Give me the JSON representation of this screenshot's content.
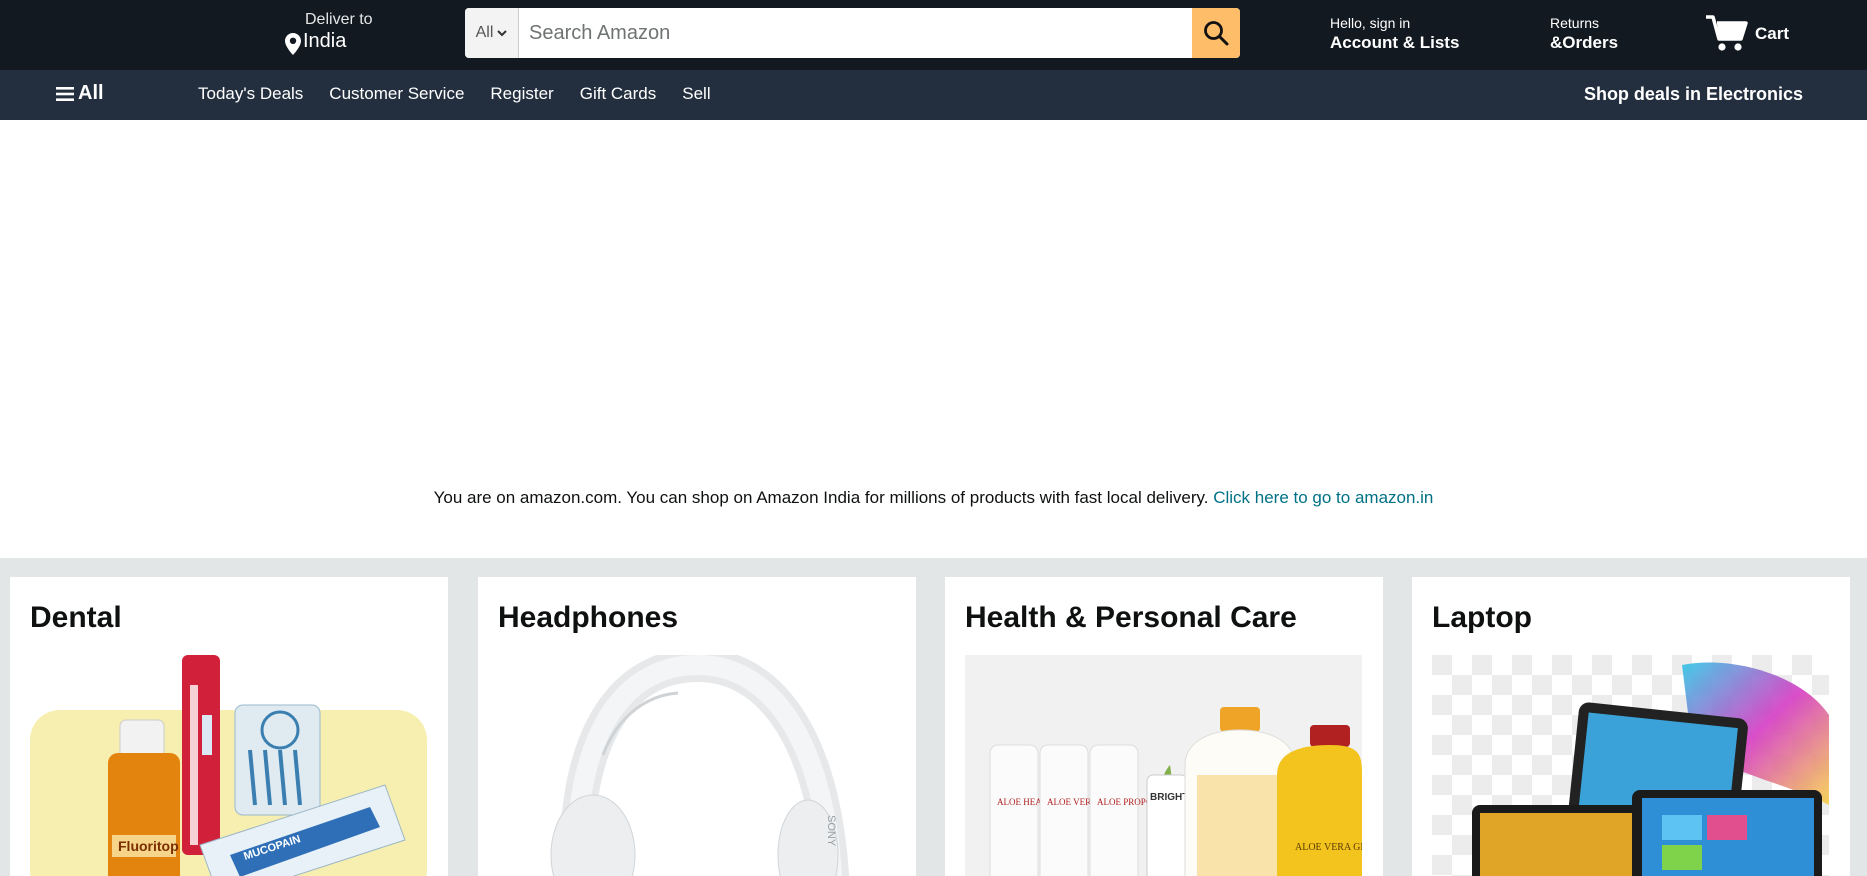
{
  "header": {
    "deliver_to": "Deliver to",
    "location": "India",
    "search": {
      "category": "All",
      "placeholder": "Search Amazon"
    },
    "account": {
      "greeting": "Hello, sign in",
      "label": "Account & Lists"
    },
    "returns": {
      "line1": "Returns",
      "line2": "&Orders"
    },
    "cart_label": "Cart"
  },
  "nav": {
    "all_label": "All",
    "links": [
      "Today's Deals",
      "Customer Service",
      "Register",
      "Gift Cards",
      "Sell"
    ],
    "promo": "Shop deals in Electronics"
  },
  "notice": {
    "text": "You are on amazon.com. You can shop on Amazon India for millions of products with fast local delivery.",
    "link": "Click here to go to amazon.in"
  },
  "cards": [
    {
      "title": "Dental"
    },
    {
      "title": "Headphones"
    },
    {
      "title": "Health & Personal Care"
    },
    {
      "title": "Laptop"
    }
  ],
  "product_labels": {
    "fluoritop": "Fluoritop",
    "mucopain": "MUCOPAIN",
    "sony": "SONY",
    "aloe_heat_lotion": "ALOE HEAT LOTION",
    "aloe_vera_gelly": "ALOE VERA GELLY",
    "aloe_propolis_creme": "ALOE PROPOLIS CREME",
    "bright": "BRIGHT",
    "aloe_vera_gel": "ALOE VERA GEL"
  },
  "colors": {
    "header_bg": "#131921",
    "nav_bg": "#232f3e",
    "search_button": "#febd69",
    "link": "#007185",
    "section_bg": "#e3e6e6"
  },
  "icons": {
    "location": "location-pin-icon",
    "search": "search-icon",
    "cart": "cart-icon",
    "menu": "hamburger-menu-icon"
  }
}
